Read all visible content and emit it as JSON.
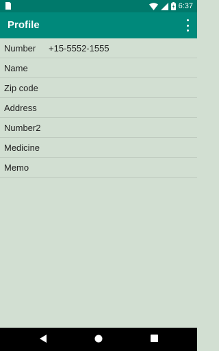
{
  "status_bar": {
    "time": "6:37",
    "icons": [
      "notification-icon",
      "wifi-icon",
      "signal-icon",
      "battery-icon"
    ],
    "color": "#00796b"
  },
  "app_bar": {
    "title": "Profile",
    "menu_icon": "overflow-menu-icon",
    "color": "#00897b"
  },
  "profile": {
    "fields": [
      {
        "label": "Number",
        "value": "+15-5552-1555"
      },
      {
        "label": "Name",
        "value": ""
      },
      {
        "label": "Zip code",
        "value": ""
      },
      {
        "label": "Address",
        "value": ""
      },
      {
        "label": "Number2",
        "value": ""
      },
      {
        "label": "Medicine",
        "value": ""
      },
      {
        "label": "Memo",
        "value": ""
      }
    ]
  },
  "nav_bar": {
    "buttons": [
      "back-icon",
      "home-icon",
      "recents-icon"
    ]
  },
  "colors": {
    "background": "#d2dfd2",
    "divider": "#bfcabf"
  }
}
